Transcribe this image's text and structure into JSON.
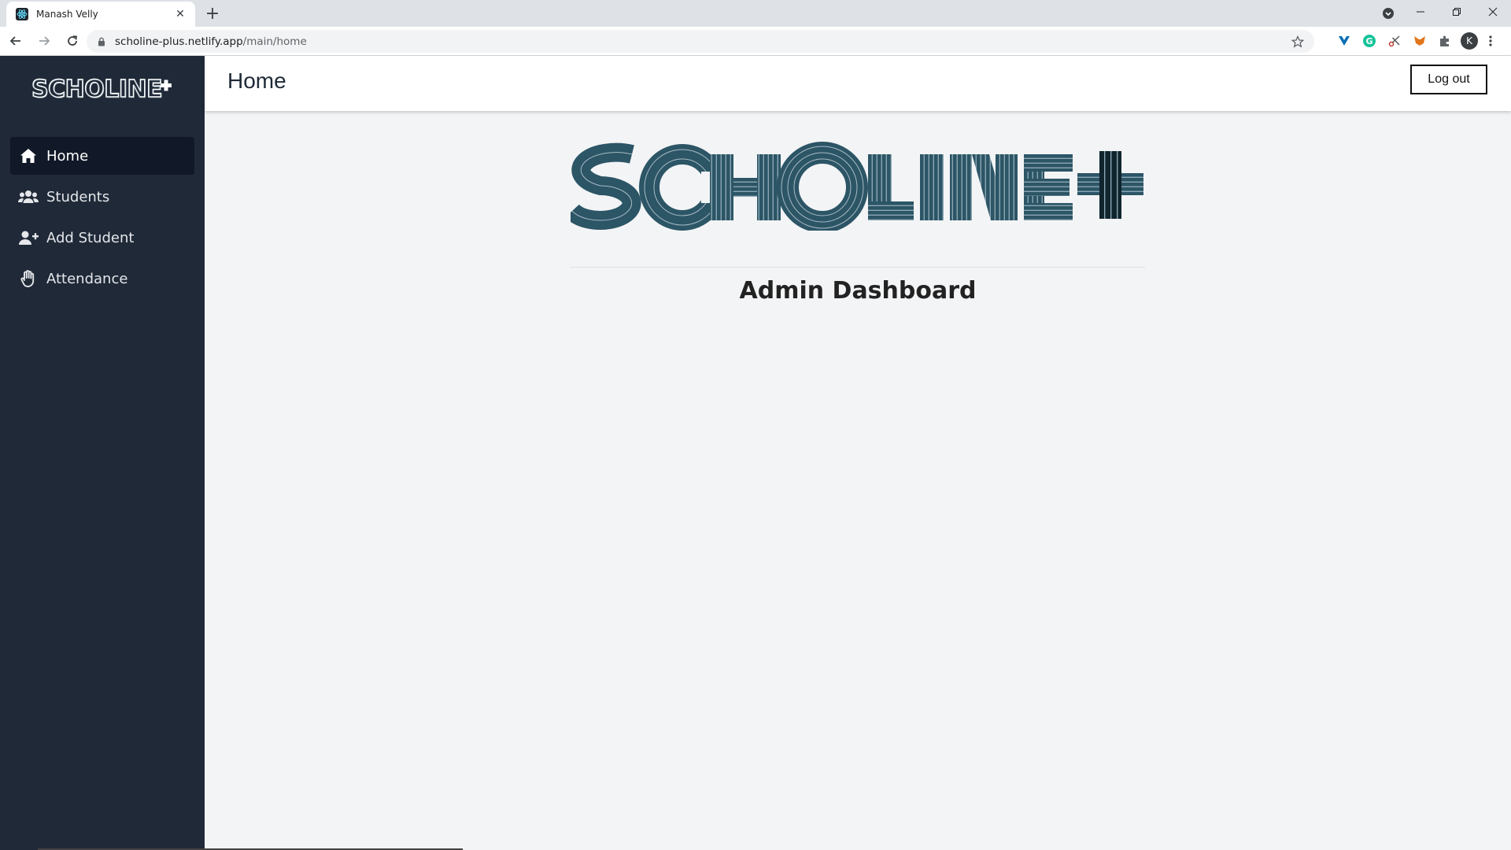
{
  "browser": {
    "tab_title": "Manash Velly",
    "url_host": "scholine-plus.netlify.app",
    "url_path": "/main/home",
    "profile_initial": "K"
  },
  "sidebar": {
    "logo_text": "SCHOLINE+",
    "items": [
      {
        "label": "Home",
        "icon": "home-icon",
        "active": true
      },
      {
        "label": "Students",
        "icon": "users-icon",
        "active": false
      },
      {
        "label": "Add Student",
        "icon": "user-plus-icon",
        "active": false
      },
      {
        "label": "Attendance",
        "icon": "hand-icon",
        "active": false
      }
    ]
  },
  "header": {
    "title": "Home",
    "logout_label": "Log out"
  },
  "main": {
    "logo_text": "SCHOLINE+",
    "subtitle": "Admin Dashboard"
  },
  "colors": {
    "sidebar_bg": "#1f2937",
    "sidebar_active": "#111827",
    "logo_teal": "#2c5566",
    "content_bg": "#f3f4f6"
  }
}
